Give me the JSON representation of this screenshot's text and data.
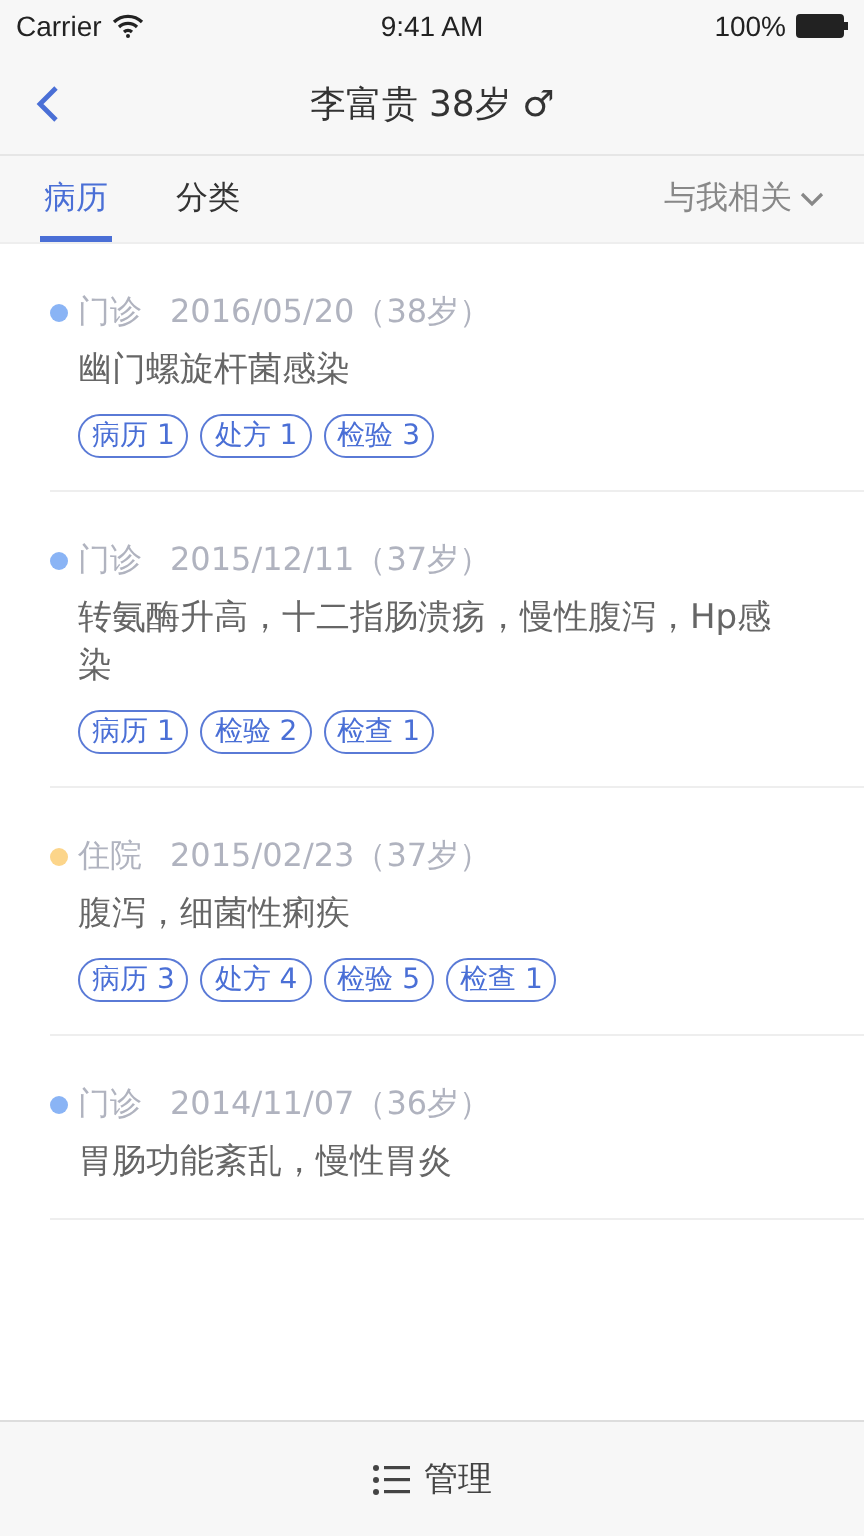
{
  "status_bar": {
    "carrier": "Carrier",
    "time": "9:41 AM",
    "battery": "100%"
  },
  "nav": {
    "title": "李富贵 38岁 ♂"
  },
  "tabs": [
    {
      "label": "病历",
      "selected": true
    },
    {
      "label": "分类",
      "selected": false
    }
  ],
  "filter": {
    "label": "与我相关"
  },
  "records": [
    {
      "type": "门诊",
      "color": "#8ab4f5",
      "date": "2016/05/20（38岁）",
      "diagnosis": "幽门螺旋杆菌感染",
      "tags": [
        "病历 1",
        "处方 1",
        "检验 3"
      ]
    },
    {
      "type": "门诊",
      "color": "#8ab4f5",
      "date": "2015/12/11（37岁）",
      "diagnosis": "转氨酶升高，十二指肠溃疡，慢性腹泻，Hp感染",
      "tags": [
        "病历 1",
        "检验 2",
        "检查 1"
      ]
    },
    {
      "type": "住院",
      "color": "#fcd58a",
      "date": "2015/02/23（37岁）",
      "diagnosis": "腹泻，细菌性痢疾",
      "tags": [
        "病历 3",
        "处方 4",
        "检验 5",
        "检查 1"
      ]
    },
    {
      "type": "门诊",
      "color": "#8ab4f5",
      "date": "2014/11/07（36岁）",
      "diagnosis": "胃肠功能紊乱，慢性胃炎"
    }
  ],
  "bottom_bar": {
    "label": "管理"
  }
}
